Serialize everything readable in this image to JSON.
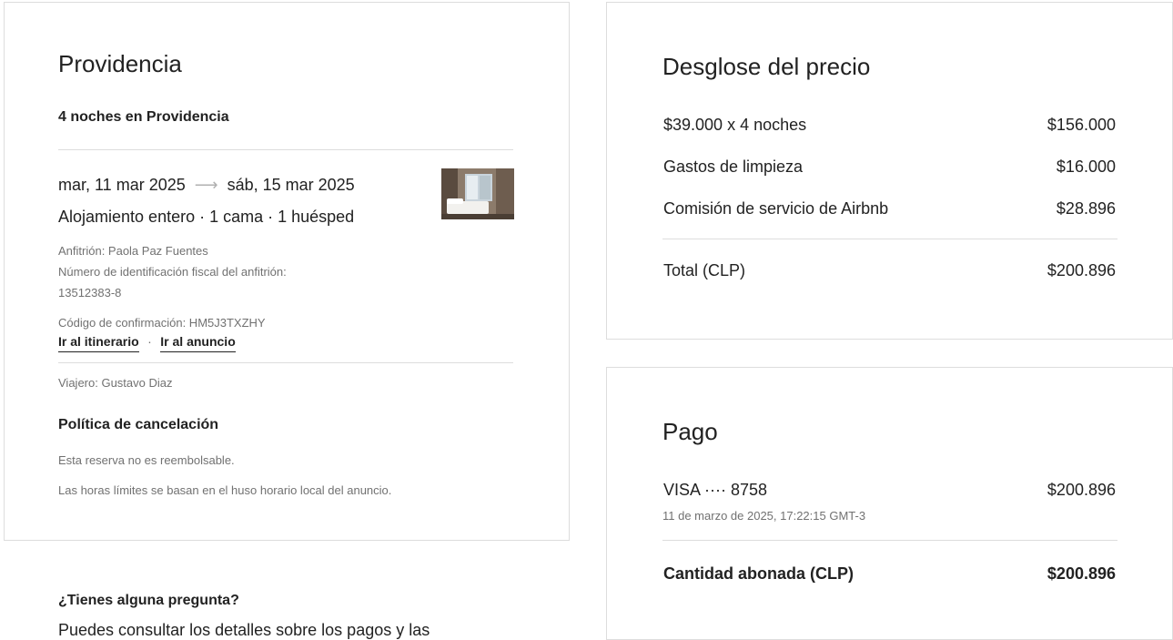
{
  "left_card": {
    "title": "Providencia",
    "nights_heading": "4 noches en Providencia",
    "checkin": "mar, 11 mar 2025",
    "arrow": "⟶",
    "checkout": "sáb, 15 mar 2025",
    "accommodation": "Alojamiento entero · 1 cama · 1 huésped",
    "host": "Anfitrión: Paola Paz Fuentes",
    "host_tax_label": "Número de identificación fiscal del anfitrión:",
    "host_tax_id": "13512383-8",
    "confirmation": "Código de confirmación: HM5J3TXZHY",
    "link_itinerary": "Ir al itinerario",
    "link_separator": "·",
    "link_listing": "Ir al anuncio",
    "traveler": "Viajero: Gustavo Diaz",
    "cancel_heading": "Política de cancelación",
    "cancel_text_1": "Esta reserva no es reembolsable.",
    "cancel_text_2": "Las horas límites se basan en el huso horario local del anuncio."
  },
  "questions": {
    "heading": "¿Tienes alguna pregunta?",
    "text": "Puedes consultar los detalles sobre los pagos y las"
  },
  "price_breakdown": {
    "title": "Desglose del precio",
    "rows": [
      {
        "label": "$39.000 x 4 noches",
        "value": "$156.000"
      },
      {
        "label": "Gastos de limpieza",
        "value": "$16.000"
      },
      {
        "label": "Comisión de servicio de Airbnb",
        "value": "$28.896"
      }
    ],
    "total_label": "Total (CLP)",
    "total_value": "$200.896"
  },
  "payment": {
    "title": "Pago",
    "method": "VISA ···· 8758",
    "method_amount": "$200.896",
    "timestamp": "11 de marzo de 2025, 17:22:15 GMT-3",
    "paid_label": "Cantidad abonada (CLP)",
    "paid_value": "$200.896"
  },
  "colors": {
    "text": "#222222",
    "muted": "#717171",
    "border": "#dddddd"
  }
}
